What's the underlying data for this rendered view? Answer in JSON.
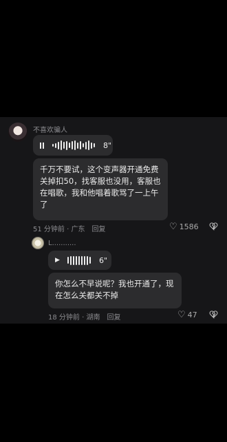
{
  "comment1": {
    "username": "不喜欢骗人",
    "voice_duration": "8\"",
    "text": "千万不要试，这个变声器开通免费关掉扣50，找客服也没用，客服也在唱歌，我和他唱着歌骂了一上午了",
    "time": "51 分钟前",
    "location": "广东",
    "reply_label": "回复",
    "likes": "1586"
  },
  "comment2": {
    "username": "L...........",
    "voice_duration": "6\"",
    "text": "你怎么不早说呢？我也开通了，现在怎么关都关不掉",
    "time": "18 分钟前",
    "location": "湖南",
    "reply_label": "回复",
    "likes": "47"
  },
  "icons": {
    "heart": "heart-outline-icon",
    "dislike": "broken-heart-icon",
    "play": "play-icon",
    "pause": "pause-icon"
  }
}
